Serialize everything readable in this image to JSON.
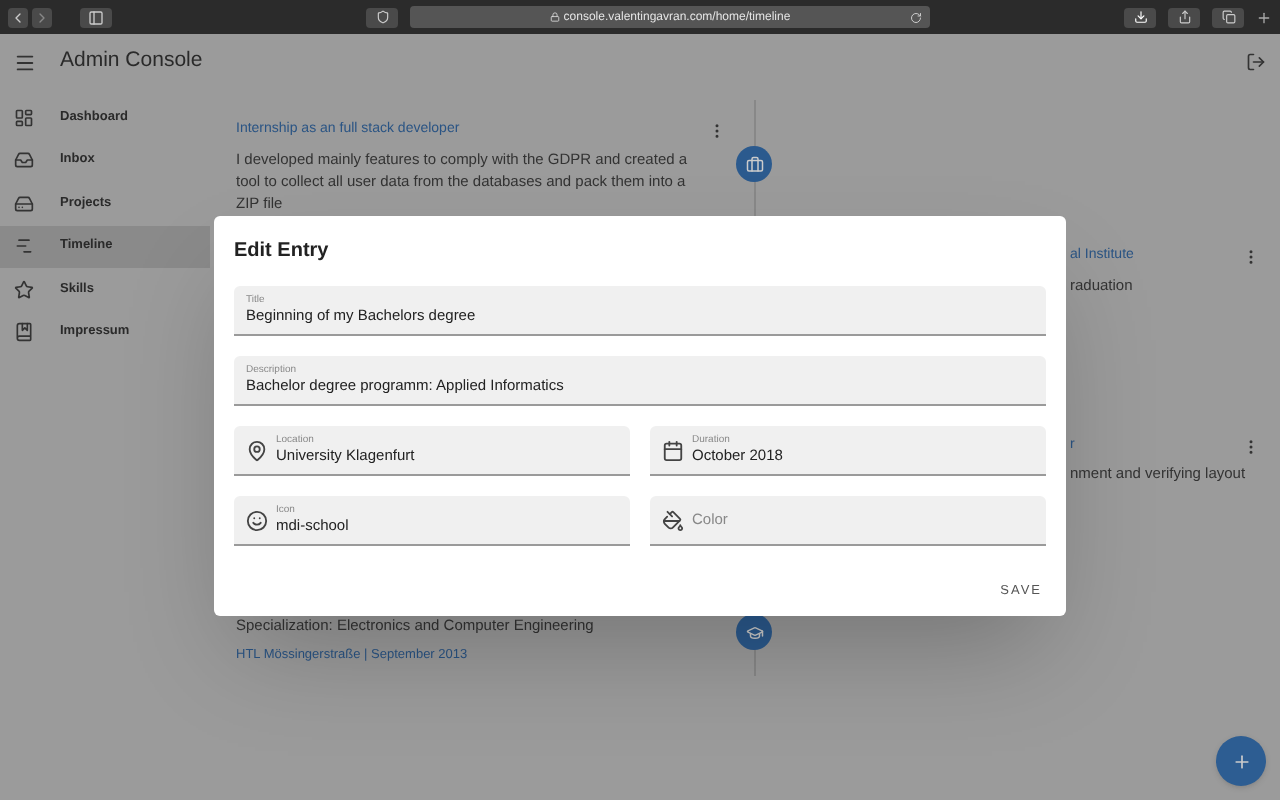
{
  "browser": {
    "url": "console.valentingavran.com/home/timeline"
  },
  "app": {
    "title": "Admin Console"
  },
  "sidebar": {
    "items": [
      {
        "label": "Dashboard",
        "selected": false
      },
      {
        "label": "Inbox",
        "selected": false
      },
      {
        "label": "Projects",
        "selected": false
      },
      {
        "label": "Timeline",
        "selected": true
      },
      {
        "label": "Skills",
        "selected": false
      },
      {
        "label": "Impressum",
        "selected": false
      }
    ]
  },
  "timeline": {
    "left_top": {
      "title": "Internship as an full stack developer",
      "description": "I developed mainly features to comply with the GDPR and created a tool to collect all user data from the databases and pack them into a ZIP file"
    },
    "left_bottom": {
      "description": "Specialization: Electronics and Computer Engineering",
      "footer": "HTL Mössingerstraße | September 2013"
    },
    "right": [
      {
        "title": "al Institute",
        "description": "raduation"
      },
      {
        "title": "r",
        "description": "nment and verifying layout"
      }
    ]
  },
  "dialog": {
    "title": "Edit Entry",
    "fields": [
      {
        "kind": "text",
        "label": "Title",
        "value": "Beginning of my Bachelors degree"
      },
      {
        "kind": "text",
        "label": "Description",
        "value": "Bachelor degree programm: Applied Informatics"
      },
      {
        "kind": "location",
        "label": "Location",
        "value": "University Klagenfurt"
      },
      {
        "kind": "date",
        "label": "Duration",
        "value": "October 2018"
      },
      {
        "kind": "emoji",
        "label": "Icon",
        "value": "mdi-school"
      },
      {
        "kind": "color",
        "placeholder": "Color"
      }
    ],
    "button": "SAVE"
  }
}
